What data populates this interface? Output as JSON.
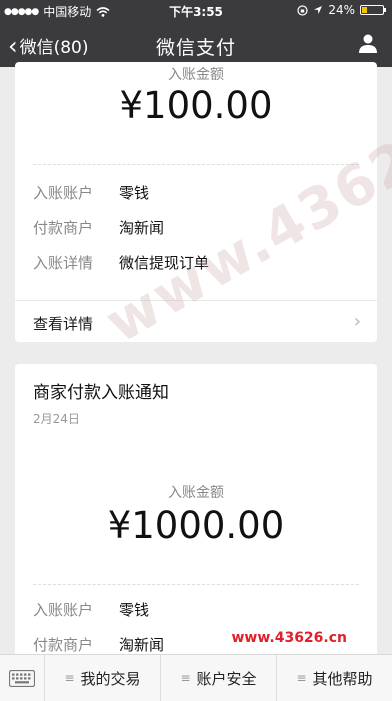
{
  "status_bar": {
    "carrier": "中国移动",
    "time": "下午3:55",
    "battery": "24%"
  },
  "navbar": {
    "back_label": "微信(80)",
    "title": "微信支付",
    "icons": {
      "back": "chevron-left-icon",
      "profile": "person-icon"
    }
  },
  "card1": {
    "amount_label": "入账金额",
    "amount": "¥100.00",
    "rows": [
      {
        "key": "入账账户",
        "value": "零钱"
      },
      {
        "key": "付款商户",
        "value": "淘新闻"
      },
      {
        "key": "入账详情",
        "value": "微信提现订单"
      }
    ],
    "detail_link": "查看详情"
  },
  "card2": {
    "title": "商家付款入账通知",
    "date": "2月24日",
    "amount_label": "入账金额",
    "amount": "¥1000.00",
    "rows": [
      {
        "key": "入账账户",
        "value": "零钱"
      },
      {
        "key": "付款商户",
        "value": "淘新闻"
      }
    ]
  },
  "watermark": {
    "diagonal": "www.43626.cn",
    "corner": "www.43626.cn"
  },
  "bottom_bar": {
    "tabs": [
      "我的交易",
      "账户安全",
      "其他帮助"
    ]
  },
  "colors": {
    "topbar": "#3b3b3d",
    "background": "#ececec",
    "watermark_red": "#e0202a"
  }
}
